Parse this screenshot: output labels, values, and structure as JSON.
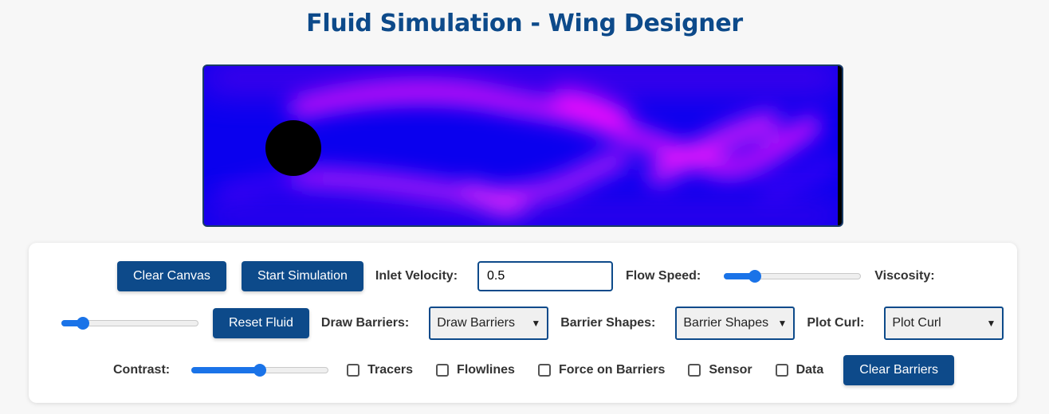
{
  "page": {
    "title": "Fluid Simulation - Wing Designer"
  },
  "simulation": {
    "obstacle": "circle",
    "colors": {
      "base": "#0a00ee",
      "vortex": "#ff00ff",
      "obstacle": "#000000"
    }
  },
  "controls": {
    "clear_canvas": "Clear Canvas",
    "start_simulation": "Start Simulation",
    "inlet_velocity_label": "Inlet Velocity:",
    "inlet_velocity_value": "0.5",
    "flow_speed_label": "Flow Speed:",
    "flow_speed_level": 0.2,
    "viscosity_label": "Viscosity:",
    "viscosity_level": 0.12,
    "reset_fluid": "Reset Fluid",
    "draw_barriers_label": "Draw Barriers:",
    "draw_barriers_value": "Draw Barriers",
    "barrier_shapes_label": "Barrier Shapes:",
    "barrier_shapes_value": "Barrier Shapes",
    "plot_curl_label": "Plot Curl:",
    "plot_curl_value": "Plot Curl",
    "contrast_label": "Contrast:",
    "contrast_level": 0.5,
    "tracers": "Tracers",
    "flowlines": "Flowlines",
    "force_on_barriers": "Force on Barriers",
    "sensor": "Sensor",
    "data": "Data",
    "clear_barriers": "Clear Barriers"
  },
  "accent": "#0d4a8a",
  "slider_color": "#1a73e8"
}
